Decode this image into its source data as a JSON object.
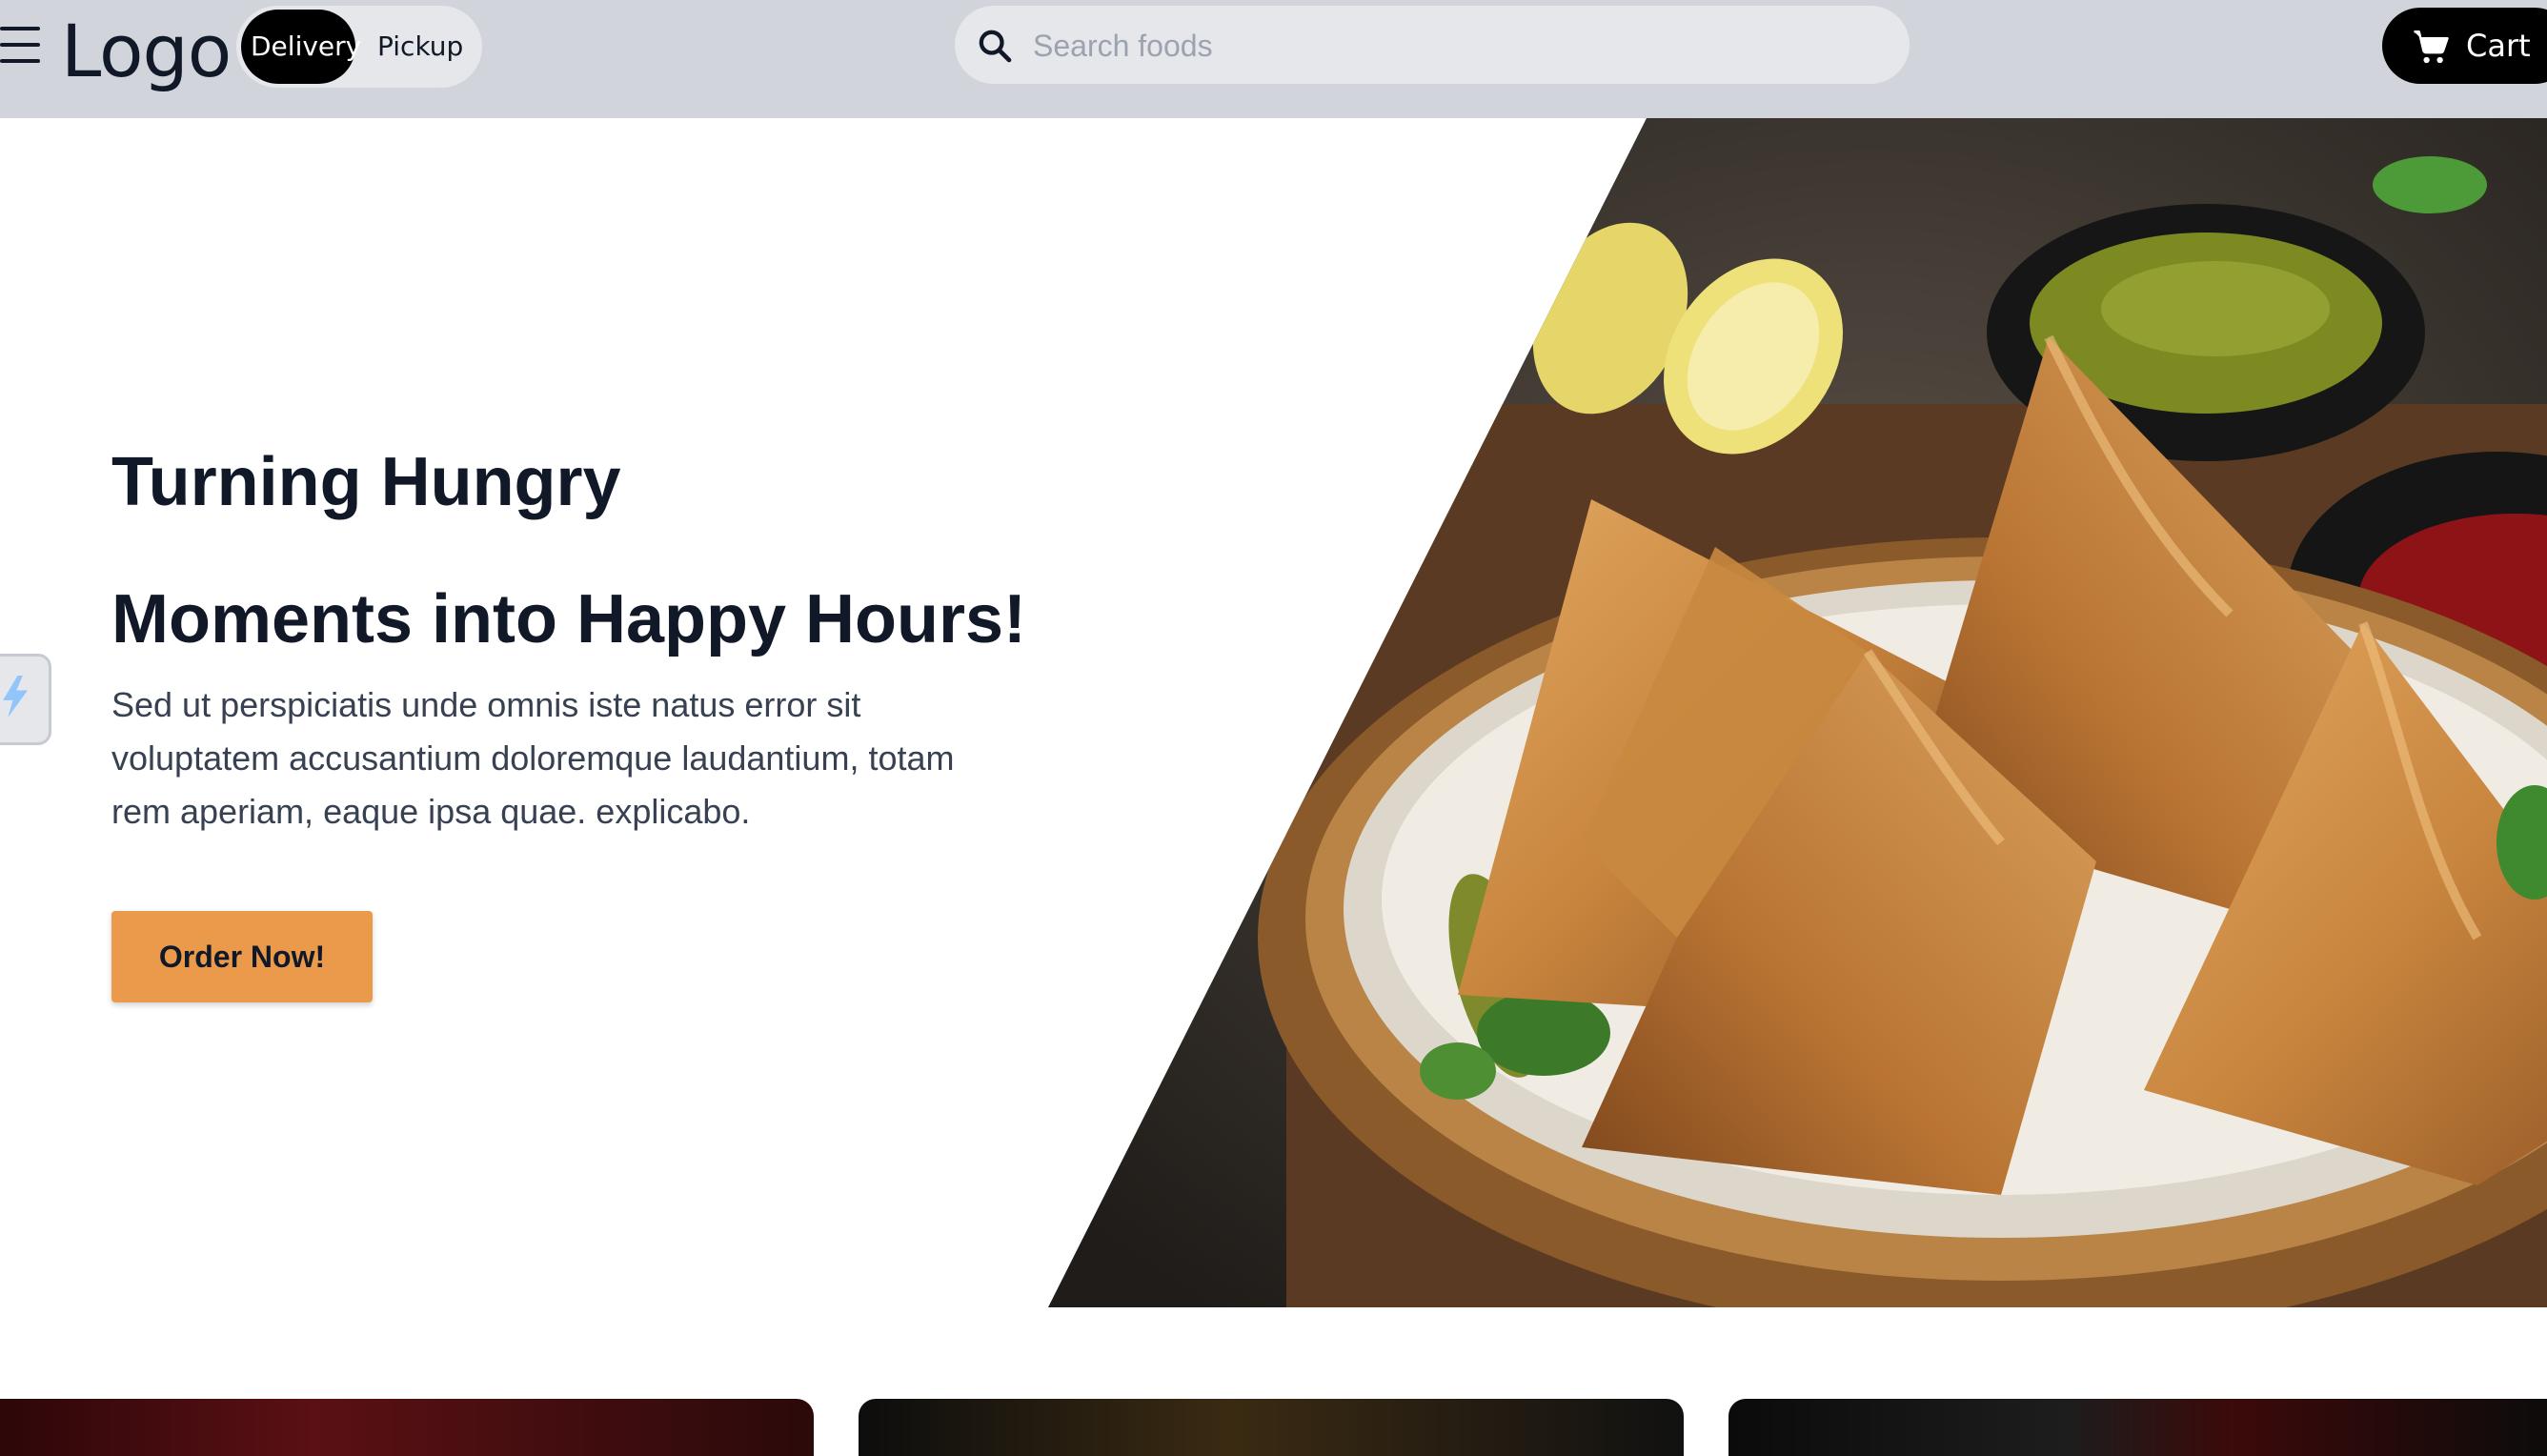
{
  "header": {
    "logo": "Logo",
    "mode_toggle": {
      "options": [
        "Delivery",
        "Pickup"
      ],
      "selected": "Delivery"
    },
    "search": {
      "placeholder": "Search foods",
      "value": ""
    },
    "cart_label": "Cart"
  },
  "hero": {
    "title_line1": "Turning Hungry",
    "title_line2": "Moments into Happy Hours!",
    "description": "Sed ut perspiciatis unde omnis iste natus error sit voluptatem accusantium doloremque laudantium, totam rem aperiam, eaque ipsa quae. explicabo.",
    "cta_label": "Order Now!"
  },
  "icons": [
    "menu-icon",
    "search-icon",
    "cart-icon",
    "bolt-icon"
  ],
  "colors": {
    "header_bg": "#d1d5db",
    "toggle_active": "#000000",
    "cart_button": "#000000",
    "cta": "#ea9a4a",
    "heading": "#111827"
  }
}
